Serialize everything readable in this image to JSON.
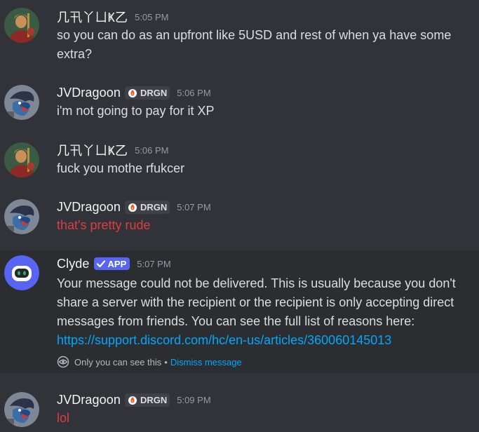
{
  "messages": [
    {
      "username": "几卂丫ㄩҜ乙",
      "time": "5:05 PM",
      "text": "so you can do as an upfront like 5USD and rest of when ya have some extra?"
    },
    {
      "username": "JVDragoon",
      "tag": "DRGN",
      "time": "5:06 PM",
      "text": "i'm not going to pay for it XP"
    },
    {
      "username": "几卂丫ㄩҜ乙",
      "time": "5:06 PM",
      "text": "fuck you mothe rfukcer"
    },
    {
      "username": "JVDragoon",
      "tag": "DRGN",
      "time": "5:07 PM",
      "text": "that's pretty rude"
    },
    {
      "username": "Clyde",
      "badge": "APP",
      "time": "5:07 PM",
      "text": "Your message could not be delivered. This is usually because you don't share a server with the recipient or the recipient is only accepting direct messages from friends. You can see the full list of reasons here: ",
      "link": "https://support.discord.com/hc/en-us/articles/360060145013",
      "ephemeral_note": "Only you can see this",
      "separator": "•",
      "dismiss_label": "Dismiss message"
    },
    {
      "username": "JVDragoon",
      "tag": "DRGN",
      "time": "5:09 PM",
      "text": "lol"
    }
  ],
  "colors": {
    "background": "#313338",
    "highlight": "#2b2d31",
    "username": "#f2f3f5",
    "text": "#dbdee1",
    "error_text": "#da3e44",
    "link": "#00a8fc",
    "app_badge": "#5865f2",
    "timestamp": "#949ba4"
  },
  "icons": {
    "tag_icon": "fire-icon",
    "badge_icon": "checkmark-icon",
    "ephemeral_icon": "eye-icon"
  }
}
